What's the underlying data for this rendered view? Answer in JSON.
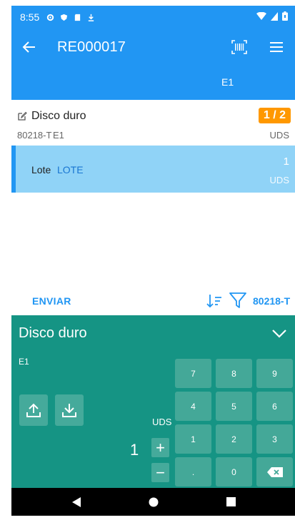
{
  "status_bar": {
    "time": "8:55"
  },
  "toolbar": {
    "title": "RE000017"
  },
  "location_header": "E1",
  "item": {
    "name": "Disco duro",
    "code": "80218-T",
    "location": "E1",
    "progress": "1 / 2",
    "unit": "UDS"
  },
  "lot": {
    "label": "Lote",
    "value": "LOTE",
    "quantity": "1",
    "unit": "UDS"
  },
  "actions": {
    "send_label": "ENVIAR",
    "filter_value": "80218-T"
  },
  "panel": {
    "name": "Disco duro",
    "location": "E1",
    "unit": "UDS",
    "quantity": "1",
    "plus": "+",
    "minus": "−"
  },
  "keypad": {
    "k7": "7",
    "k8": "8",
    "k9": "9",
    "k4": "4",
    "k5": "5",
    "k6": "6",
    "k1": "1",
    "k2": "2",
    "k3": "3",
    "dot": ".",
    "k0": "0"
  },
  "colors": {
    "primary": "#2196f3",
    "selected_row": "#90d3f7",
    "badge": "#ff9800",
    "panel": "#159484",
    "key": "#44a898"
  }
}
